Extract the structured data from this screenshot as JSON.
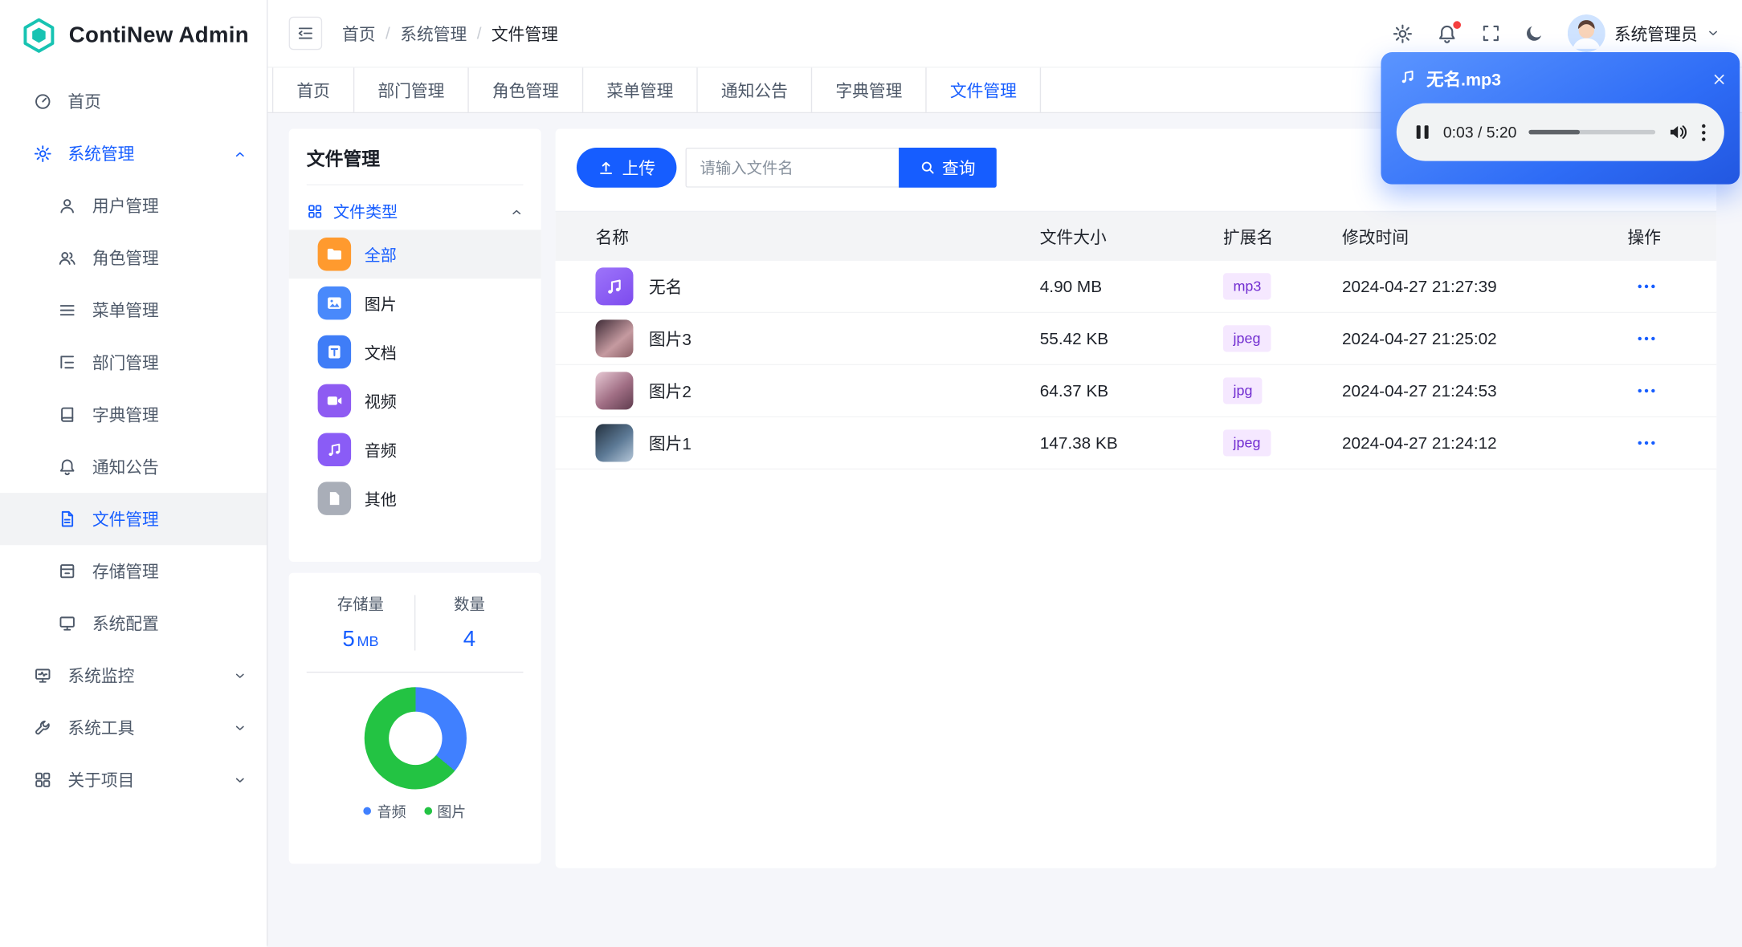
{
  "app": {
    "brand": "ContiNew Admin"
  },
  "header": {
    "breadcrumb": {
      "separator": "/",
      "items": [
        {
          "label": "首页"
        },
        {
          "label": "系统管理"
        },
        {
          "label": "文件管理"
        }
      ]
    },
    "username": "系统管理员"
  },
  "tabs": {
    "active": "文件管理",
    "items": [
      {
        "label": "首页"
      },
      {
        "label": "部门管理"
      },
      {
        "label": "角色管理"
      },
      {
        "label": "菜单管理"
      },
      {
        "label": "通知公告"
      },
      {
        "label": "字典管理"
      },
      {
        "label": "文件管理"
      }
    ]
  },
  "sidebar": {
    "items": [
      {
        "label": "首页",
        "icon": "home-icon"
      },
      {
        "label": "系统管理",
        "icon": "gear-icon",
        "expanded": true
      },
      {
        "label": "用户管理",
        "icon": "user-icon"
      },
      {
        "label": "角色管理",
        "icon": "users-icon"
      },
      {
        "label": "菜单管理",
        "icon": "list-icon"
      },
      {
        "label": "部门管理",
        "icon": "tree-icon"
      },
      {
        "label": "字典管理",
        "icon": "book-icon"
      },
      {
        "label": "通知公告",
        "icon": "bell-icon"
      },
      {
        "label": "文件管理",
        "icon": "file-icon",
        "selected": true
      },
      {
        "label": "存储管理",
        "icon": "storage-icon"
      },
      {
        "label": "系统配置",
        "icon": "display-icon"
      },
      {
        "label": "系统监控",
        "icon": "monitor-icon",
        "collapsed": true
      },
      {
        "label": "系统工具",
        "icon": "wrench-icon",
        "collapsed": true
      },
      {
        "label": "关于项目",
        "icon": "grid-icon",
        "collapsed": true
      }
    ]
  },
  "file_panel": {
    "title": "文件管理",
    "group_label": "文件类型",
    "selected_type": "全部",
    "types": [
      {
        "label": "全部",
        "icon": "folder-icon"
      },
      {
        "label": "图片",
        "icon": "image-icon"
      },
      {
        "label": "文档",
        "icon": "doc-icon"
      },
      {
        "label": "视频",
        "icon": "video-icon"
      },
      {
        "label": "音频",
        "icon": "audio-icon"
      },
      {
        "label": "其他",
        "icon": "other-file-icon"
      }
    ],
    "stats": {
      "storage_label": "存储量",
      "storage_value": "5",
      "storage_unit": "MB",
      "count_label": "数量",
      "count_value": "4"
    }
  },
  "toolbar": {
    "upload_label": "上传",
    "search_placeholder": "请输入文件名",
    "query_label": "查询"
  },
  "table": {
    "headers": [
      "名称",
      "文件大小",
      "扩展名",
      "修改时间",
      "操作"
    ],
    "rows": [
      {
        "name": "无名",
        "size": "4.90 MB",
        "ext": "mp3",
        "time": "2024-04-27 21:27:39",
        "kind": "audio"
      },
      {
        "name": "图片3",
        "size": "55.42 KB",
        "ext": "jpeg",
        "time": "2024-04-27 21:25:02",
        "kind": "image"
      },
      {
        "name": "图片2",
        "size": "64.37 KB",
        "ext": "jpg",
        "time": "2024-04-27 21:24:53",
        "kind": "image"
      },
      {
        "name": "图片1",
        "size": "147.38 KB",
        "ext": "jpeg",
        "time": "2024-04-27 21:24:12",
        "kind": "image"
      }
    ]
  },
  "player": {
    "title": "无名.mp3",
    "time": "0:03 / 5:20"
  },
  "chart_data": {
    "type": "pie",
    "donut": true,
    "legend_position": "bottom",
    "segments": [
      {
        "label": "音频",
        "value": 36,
        "color": "#4080FF"
      },
      {
        "label": "图片",
        "value": 64,
        "color": "#23C343"
      }
    ]
  },
  "colors": {
    "primary": "#165DFF",
    "tag_bg": "#F5E8FF",
    "tag_text": "#722ED1",
    "audio_segment": "#4080FF",
    "image_segment": "#23C343"
  }
}
